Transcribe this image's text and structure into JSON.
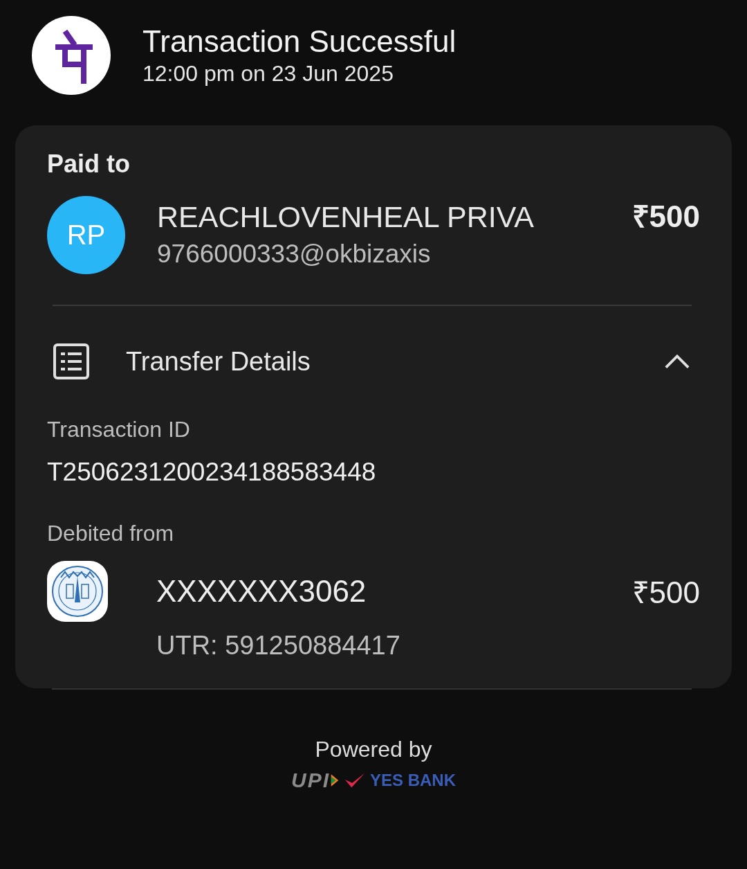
{
  "header": {
    "title": "Transaction Successful",
    "time": "12:00 pm on 23 Jun 2025"
  },
  "paid_to": {
    "heading": "Paid to",
    "initials": "RP",
    "name": "REACHLOVENHEAL PRIVA",
    "upi_id": "9766000333@okbizaxis",
    "amount": "₹500"
  },
  "transfer_details": {
    "title": "Transfer Details",
    "expanded": true,
    "fields": [
      {
        "label": "Transaction ID",
        "value": "T2506231200234188583448"
      }
    ],
    "debited_from": {
      "label": "Debited from",
      "account": "XXXXXXX3062",
      "amount": "₹500",
      "utr": "UTR: 591250884417"
    }
  },
  "footer": {
    "powered_by": "Powered by",
    "upi": "UPI",
    "bank": "YES BANK"
  }
}
